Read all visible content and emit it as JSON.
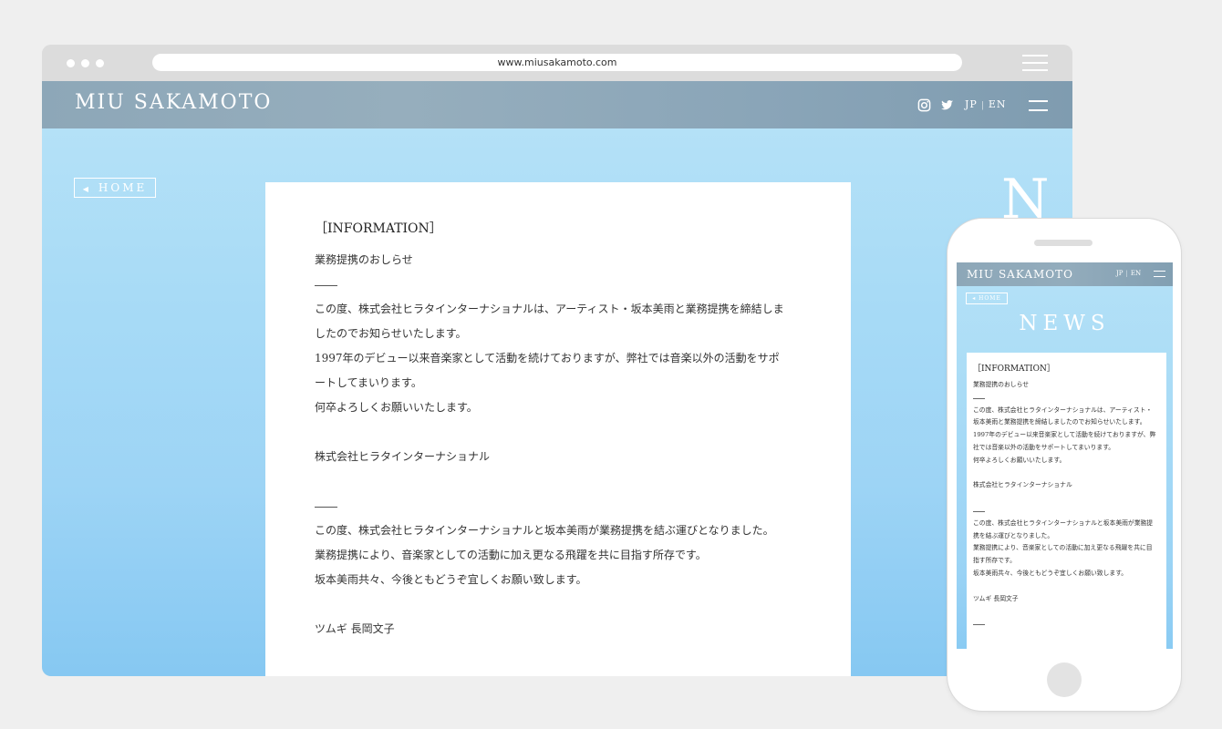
{
  "browser": {
    "url": "www.miusakamoto.com"
  },
  "site": {
    "logo": "MIU SAKAMOTO",
    "lang_jp": "JP",
    "lang_sep": "|",
    "lang_en": "EN",
    "home_label": "HOME",
    "page_heading_letter": "N"
  },
  "article": {
    "title": "［INFORMATION］",
    "subtitle": "業務提携のおしらせ",
    "p1_l1": "この度、株式会社ヒラタインターナショナルは、アーティスト・坂本美雨と業務提携を締結しま",
    "p1_l2": "したのでお知らせいたします。",
    "p1_l3": "1997年のデビュー以来音楽家として活動を続けておりますが、弊社では音楽以外の活動をサポ",
    "p1_l4": "ートしてまいります。",
    "p1_l5": "何卒よろしくお願いいたします。",
    "sign1": "株式会社ヒラタインターナショナル",
    "p2_l1": "この度、株式会社ヒラタインターナショナルと坂本美雨が業務提携を結ぶ運びとなりました。",
    "p2_l2": "業務提携により、音楽家としての活動に加え更なる飛躍を共に目指す所存です。",
    "p2_l3": "坂本美雨共々、今後ともどうぞ宜しくお願い致します。",
    "sign2": "ツムギ 長岡文子"
  },
  "mobile": {
    "logo": "MIU SAKAMOTO",
    "lang_jp": "JP",
    "lang_sep": "|",
    "lang_en": "EN",
    "home_label": "◂ HOME",
    "news_heading": "NEWS",
    "title": "［INFORMATION］",
    "subtitle": "業務提携のおしらせ",
    "p1_l1": "この度、株式会社ヒラタインターナショナルは、アーティスト・",
    "p1_l2": "坂本美雨と業務提携を締結しましたのでお知らせいたします。",
    "p1_l3": "1997年のデビュー以来音楽家として活動を続けておりますが、弊",
    "p1_l4": "社では音楽以外の活動をサポートしてまいります。",
    "p1_l5": "何卒よろしくお願いいたします。",
    "sign1": "株式会社ヒラタインターナショナル",
    "p2_l1": "この度、株式会社ヒラタインターナショナルと坂本美雨が業務提",
    "p2_l2": "携を結ぶ運びとなりました。",
    "p2_l3": "業務提携により、音楽家としての活動に加え更なる飛躍を共に目",
    "p2_l4": "指す所存です。",
    "p2_l5": "坂本美雨共々、今後ともどうぞ宜しくお願い致します。",
    "sign2": "ツムギ 長岡文子"
  },
  "colors": {
    "header_bar": "#8da7b8",
    "sky_top": "#b4e1f7",
    "sky_bottom": "#86c8f2",
    "page_bg": "#efefef"
  },
  "icons": [
    "instagram-icon",
    "twitter-icon",
    "hamburger-menu-icon",
    "back-triangle-icon"
  ]
}
